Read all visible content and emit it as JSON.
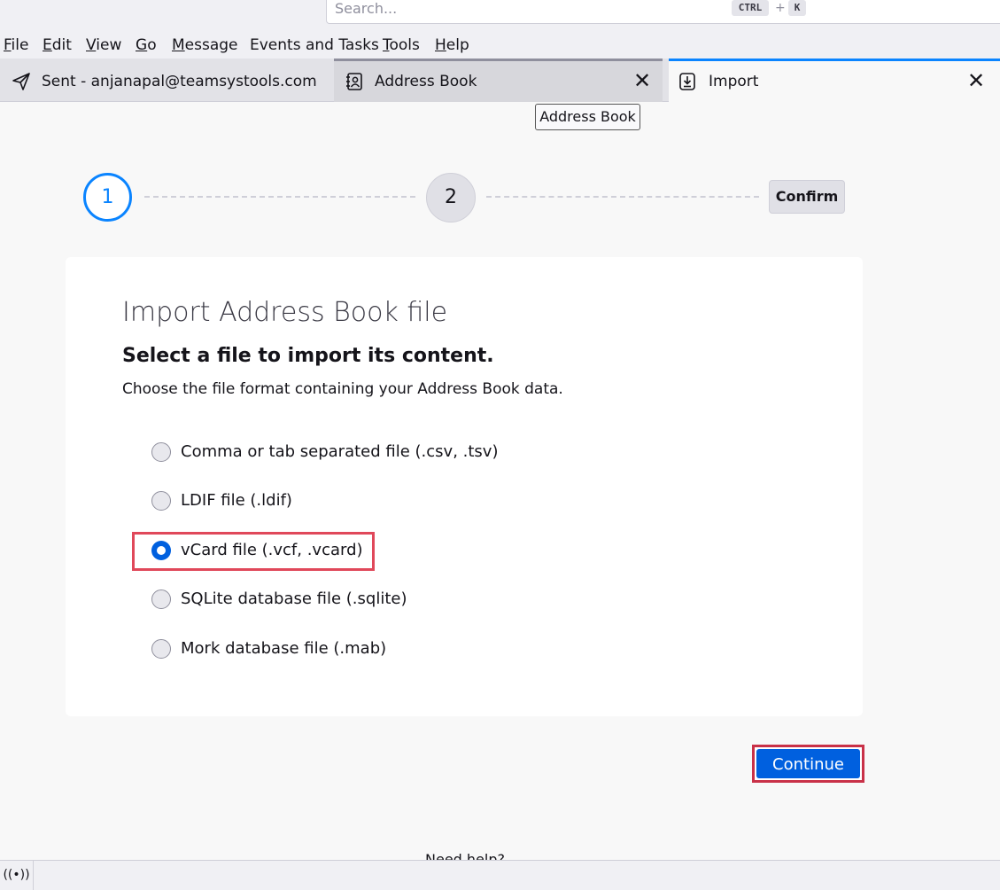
{
  "search": {
    "placeholder": "Search...",
    "key_mod": "CTRL",
    "key_plus": "+",
    "key_letter": "K"
  },
  "menu": {
    "items": [
      {
        "mnemonic": "F",
        "rest": "ile"
      },
      {
        "mnemonic": "E",
        "rest": "dit"
      },
      {
        "mnemonic": "V",
        "rest": "iew"
      },
      {
        "mnemonic": "G",
        "rest": "o"
      },
      {
        "mnemonic": "M",
        "rest": "essage"
      },
      {
        "mnemonic": "",
        "rest": "Events and Tasks"
      },
      {
        "mnemonic": "T",
        "rest": "ools"
      },
      {
        "mnemonic": "H",
        "rest": "elp"
      }
    ]
  },
  "tabs": {
    "sent": {
      "label": "Sent - anjanapal@teamsystools.com",
      "icon": "send-icon"
    },
    "address_book": {
      "label": "Address Book",
      "icon": "address-book-icon",
      "close": "✕"
    },
    "import": {
      "label": "Import",
      "icon": "import-icon",
      "close": "✕"
    }
  },
  "tooltip": {
    "text": "Address Book"
  },
  "stepper": {
    "step1": "1",
    "step2": "2",
    "confirm": "Confirm"
  },
  "card": {
    "title": "Import Address Book file",
    "subtitle": "Select a file to import its content.",
    "description": "Choose the file format containing your Address Book data.",
    "options": [
      {
        "label": "Comma or tab separated file (.csv, .tsv)",
        "selected": false
      },
      {
        "label": "LDIF file (.ldif)",
        "selected": false
      },
      {
        "label": "vCard file (.vcf, .vcard)",
        "selected": true
      },
      {
        "label": "SQLite database file (.sqlite)",
        "selected": false
      },
      {
        "label": "Mork database file (.mab)",
        "selected": false
      }
    ]
  },
  "continue_label": "Continue",
  "need_help": "Need help?",
  "status": {
    "icon": "broadcast-icon",
    "glyph": "((•))"
  },
  "colors": {
    "accent": "#0a84ff",
    "primary_button": "#0060df",
    "highlight": "#e0485a"
  }
}
